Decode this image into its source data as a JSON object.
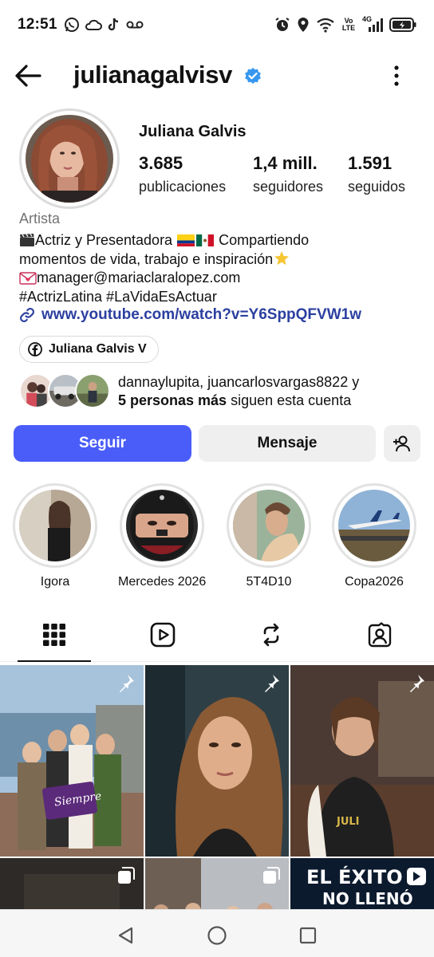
{
  "status_bar": {
    "time": "12:51",
    "left_icons": [
      "whatsapp-icon",
      "cloud-icon",
      "tiktok-icon",
      "voicemail-icon"
    ],
    "right_icons": [
      "alarm-icon",
      "location-icon",
      "wifi-icon",
      "volte-icon",
      "signal-icon",
      "battery-icon"
    ],
    "volte_label": "Vo\nLTE",
    "network_label": "4G"
  },
  "header": {
    "username": "julianagalvisv",
    "verified": true
  },
  "profile": {
    "full_name": "Juliana Galvis",
    "posts_count": "3.685",
    "posts_label": "publicaciones",
    "followers_count": "1,4 mill.",
    "followers_label": "seguidores",
    "following_count": "1.591",
    "following_label": "seguidos",
    "category": "Artista",
    "bio_line1_a": "Actriz y Presentadora",
    "bio_line1_b": "Compartiendo",
    "bio_line2": "momentos de vida, trabajo e inspiración",
    "bio_line3": "manager@mariaclaralopez.com",
    "bio_line4": "#ActrizLatina #LaVidaEsActuar",
    "link": "www.youtube.com/watch?v=Y6SppQFVW1w",
    "facebook_chip": "Juliana Galvis V",
    "followed_by_names": "dannaylupita, juancarlosvargas8822",
    "followed_by_and": "y",
    "followed_by_more": "5 personas más",
    "followed_by_suffix": "siguen esta cuenta"
  },
  "actions": {
    "follow": "Seguir",
    "message": "Mensaje"
  },
  "highlights": [
    {
      "label": "Igora"
    },
    {
      "label": "Mercedes 2026"
    },
    {
      "label": "5T4D10"
    },
    {
      "label": "Copa2026"
    }
  ],
  "tabs": [
    "grid-icon",
    "reels-icon",
    "reposts-icon",
    "tagged-icon"
  ],
  "posts": [
    {
      "pinned": true,
      "overlay_text": "Siempre"
    },
    {
      "pinned": true
    },
    {
      "pinned": true,
      "overlay_text": "JULI"
    },
    {
      "type": "carousel"
    },
    {
      "type": "carousel"
    },
    {
      "overlay_text_1": "EL ÉXITO",
      "overlay_text_2": "NO LLENÓ"
    }
  ],
  "colors": {
    "primary_button": "#4a5df9",
    "link": "#2b3fa0",
    "verified": "#3797f0",
    "secondary_button": "#efefef"
  }
}
